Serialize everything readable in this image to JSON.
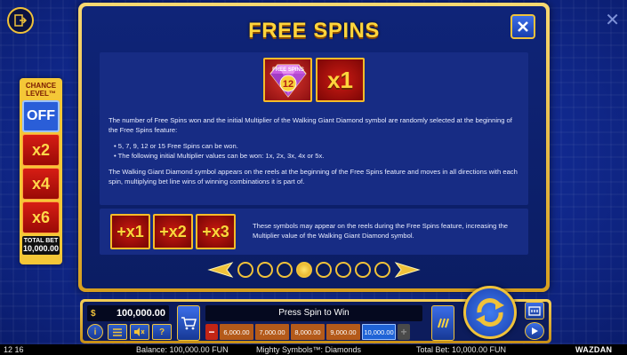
{
  "dialog": {
    "title": "FREE SPINS",
    "symbol": {
      "label": "FREE SPINS",
      "number": "12",
      "multiplier": "x1"
    },
    "paragraph1": "The number of Free Spins won and the initial Multiplier of the Walking Giant Diamond symbol are randomly selected at the beginning of the Free Spins feature:",
    "bullets": [
      "• 5, 7, 9, 12 or 15 Free Spins can be won.",
      "• The following initial Multiplier values can be won: 1x, 2x, 3x, 4x or 5x."
    ],
    "paragraph2": "The Walking Giant Diamond symbol appears on the reels at the beginning of the Free Spins feature and moves in all directions with each spin, multiplying bet line wins of winning combinations it is part of.",
    "mult_symbols": [
      "+x1",
      "+x2",
      "+x3"
    ],
    "mult_text": "These symbols may appear on the reels during the Free Spins feature, increasing the Multiplier value of the Walking Giant Diamond symbol.",
    "pages_total": 8,
    "page_current": 4
  },
  "chance_level": {
    "title_line1": "CHANCE",
    "title_line2": "LEVEL™",
    "options": [
      "OFF",
      "x2",
      "x4",
      "x6"
    ],
    "selected": "OFF",
    "total_bet_label": "TOTAL BET",
    "total_bet_value": "10,000.00"
  },
  "controls": {
    "balance": "100,000.00",
    "status": "Press Spin to Win",
    "bet_options": [
      "6,000.00",
      "7,000.00",
      "8,000.00",
      "9,000.00",
      "10,000.00"
    ],
    "selected_bet": "10,000.00",
    "icon_info": "i",
    "icon_help": "?"
  },
  "footer": {
    "time": "12 16",
    "balance": "Balance: 100,000.00 FUN",
    "game": "Mighty Symbols™: Diamonds",
    "total_bet": "Total Bet: 10,000.00 FUN",
    "brand": "WAZDAN"
  },
  "colors": {
    "gold": "#f0c23a",
    "title_yellow": "#ffd53c",
    "dialog_blue": "#0f2478",
    "tile_red": "#c8190f"
  }
}
